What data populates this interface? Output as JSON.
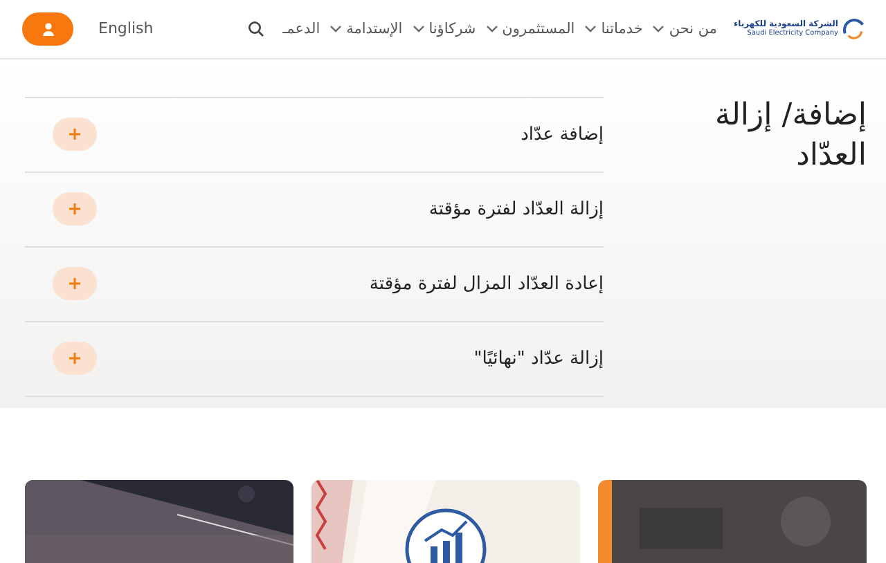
{
  "header": {
    "logo": {
      "name_ar": "الشركة السعودية للكهرباء",
      "name_en": "Saudi Electricity Company"
    },
    "nav": [
      {
        "label": "من نحن",
        "has_menu": true
      },
      {
        "label": "خدماتنا",
        "has_menu": true
      },
      {
        "label": "المستثمرون",
        "has_menu": true
      },
      {
        "label": "شركاؤنا",
        "has_menu": true
      },
      {
        "label": "الإستدامة",
        "has_menu": true
      },
      {
        "label": "الدعمـ",
        "has_menu": false
      }
    ],
    "language": "English"
  },
  "section": {
    "title": "إضافة/ إزالة العدّاد",
    "accordion": [
      {
        "label": "إضافة عدّاد",
        "expanded": false
      },
      {
        "label": "إزالة العدّاد لفترة مؤقتة",
        "expanded": false
      },
      {
        "label": "إعادة العدّاد المزال لفترة مؤقتة",
        "expanded": false
      },
      {
        "label": "إزالة عدّاد \"نهائيًا\"",
        "expanded": false
      }
    ]
  }
}
